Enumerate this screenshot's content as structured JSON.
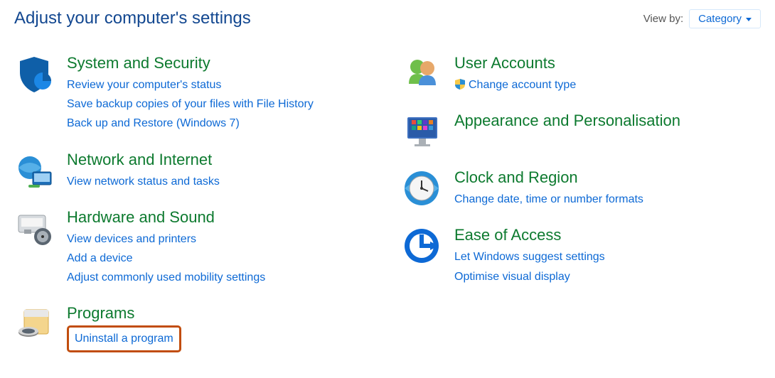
{
  "header": {
    "title": "Adjust your computer's settings",
    "view_by_label": "View by:",
    "view_by_value": "Category"
  },
  "categories_left": [
    {
      "title": "System and Security",
      "icon": "shield",
      "links": [
        "Review your computer's status",
        "Save backup copies of your files with File History",
        "Back up and Restore (Windows 7)"
      ]
    },
    {
      "title": "Network and Internet",
      "icon": "network",
      "links": [
        "View network status and tasks"
      ]
    },
    {
      "title": "Hardware and Sound",
      "icon": "hardware",
      "links": [
        "View devices and printers",
        "Add a device",
        "Adjust commonly used mobility settings"
      ]
    },
    {
      "title": "Programs",
      "icon": "programs",
      "links": [
        "Uninstall a program"
      ],
      "highlight_index": 0
    }
  ],
  "categories_right": [
    {
      "title": "User Accounts",
      "icon": "users",
      "links": [
        "Change account type"
      ],
      "shield_links": [
        0
      ]
    },
    {
      "title": "Appearance and Personalisation",
      "icon": "appearance",
      "links": []
    },
    {
      "title": "Clock and Region",
      "icon": "clock",
      "links": [
        "Change date, time or number formats"
      ]
    },
    {
      "title": "Ease of Access",
      "icon": "ease",
      "links": [
        "Let Windows suggest settings",
        "Optimise visual display"
      ]
    }
  ]
}
